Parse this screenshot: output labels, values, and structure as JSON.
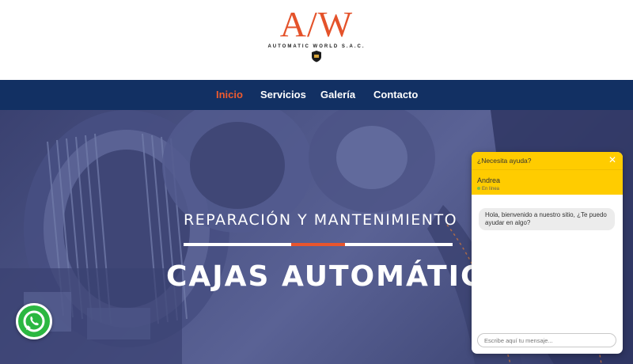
{
  "brand": {
    "logo_text": "A/W",
    "company_name": "AUTOMATIC WORLD S.A.C.",
    "accent_color": "#e4522a"
  },
  "nav": {
    "items": [
      {
        "label": "Inicio",
        "active": true
      },
      {
        "label": "Servicios",
        "active": false
      },
      {
        "label": "Galería",
        "active": false
      },
      {
        "label": "Contacto",
        "active": false
      }
    ],
    "background": "#123063",
    "active_color": "#ef5b2e"
  },
  "hero": {
    "line1": "REPARACIÓN Y MANTENIMIENTO",
    "line2": "CAJAS AUTOMÁTICAS",
    "divider_accent_color": "#e8552d"
  },
  "whatsapp": {
    "icon": "whatsapp-icon",
    "color": "#2bb741"
  },
  "chat": {
    "header_title": "¿Necesita ayuda?",
    "close_icon": "close-icon",
    "agent_name": "Andrea",
    "agent_status": "En línea",
    "message": "Hola, bienvenido a nuestro sitio, ¿Te puedo ayudar en algo?",
    "input_placeholder": "Escribe aquí tu mensaje...",
    "header_color": "#ffcc00"
  }
}
